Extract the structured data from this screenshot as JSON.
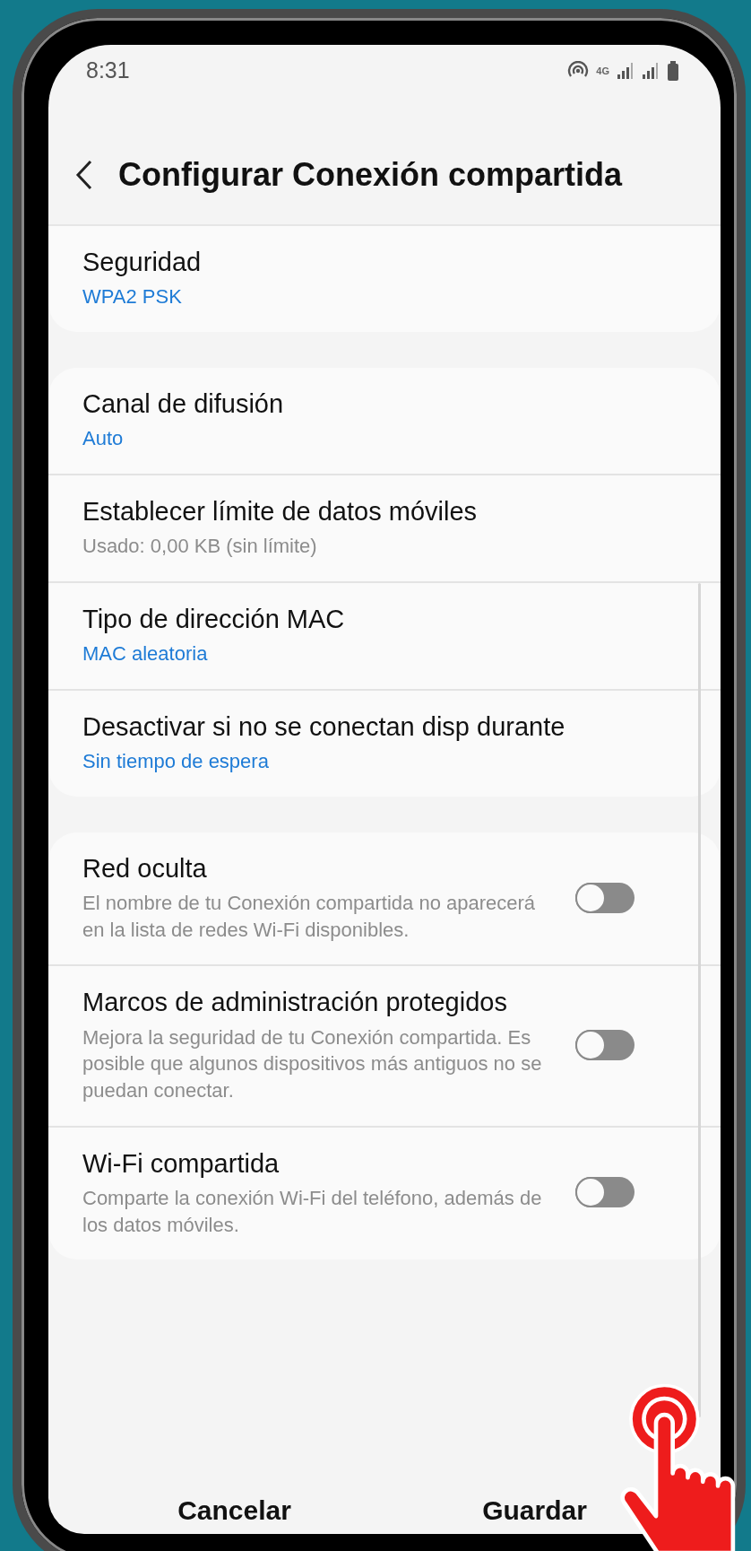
{
  "status_bar": {
    "time": "8:31",
    "network": "4G"
  },
  "header": {
    "title": "Configurar Conexión compartida"
  },
  "groups": [
    {
      "items": [
        {
          "kind": "value",
          "title": "Seguridad",
          "subtitle": "WPA2 PSK"
        }
      ]
    },
    {
      "items": [
        {
          "kind": "value",
          "title": "Canal de difusión",
          "subtitle": "Auto"
        },
        {
          "kind": "info",
          "title": "Establecer límite de datos móviles",
          "subtitle": "Usado: 0,00 KB (sin límite)"
        },
        {
          "kind": "value",
          "title": "Tipo de dirección MAC",
          "subtitle": "MAC aleatoria"
        },
        {
          "kind": "value",
          "title": "Desactivar si no se conectan disp durante",
          "subtitle": "Sin tiempo de espera"
        }
      ]
    },
    {
      "items": [
        {
          "kind": "toggle",
          "title": "Red oculta",
          "subtitle": "El nombre de tu Conexión compartida no aparecerá en la lista de redes Wi-Fi disponibles.",
          "on": false
        },
        {
          "kind": "toggle",
          "title": "Marcos de administración protegidos",
          "subtitle": "Mejora la seguridad de tu Conexión compartida. Es posible que algunos dispositivos más antiguos no se puedan conectar.",
          "on": false
        },
        {
          "kind": "toggle",
          "title": "Wi-Fi compartida",
          "subtitle": "Comparte la conexión Wi-Fi del teléfono, además de los datos móviles.",
          "on": false
        }
      ]
    }
  ],
  "buttons": [
    {
      "label": "Cancelar"
    },
    {
      "label": "Guardar"
    }
  ]
}
